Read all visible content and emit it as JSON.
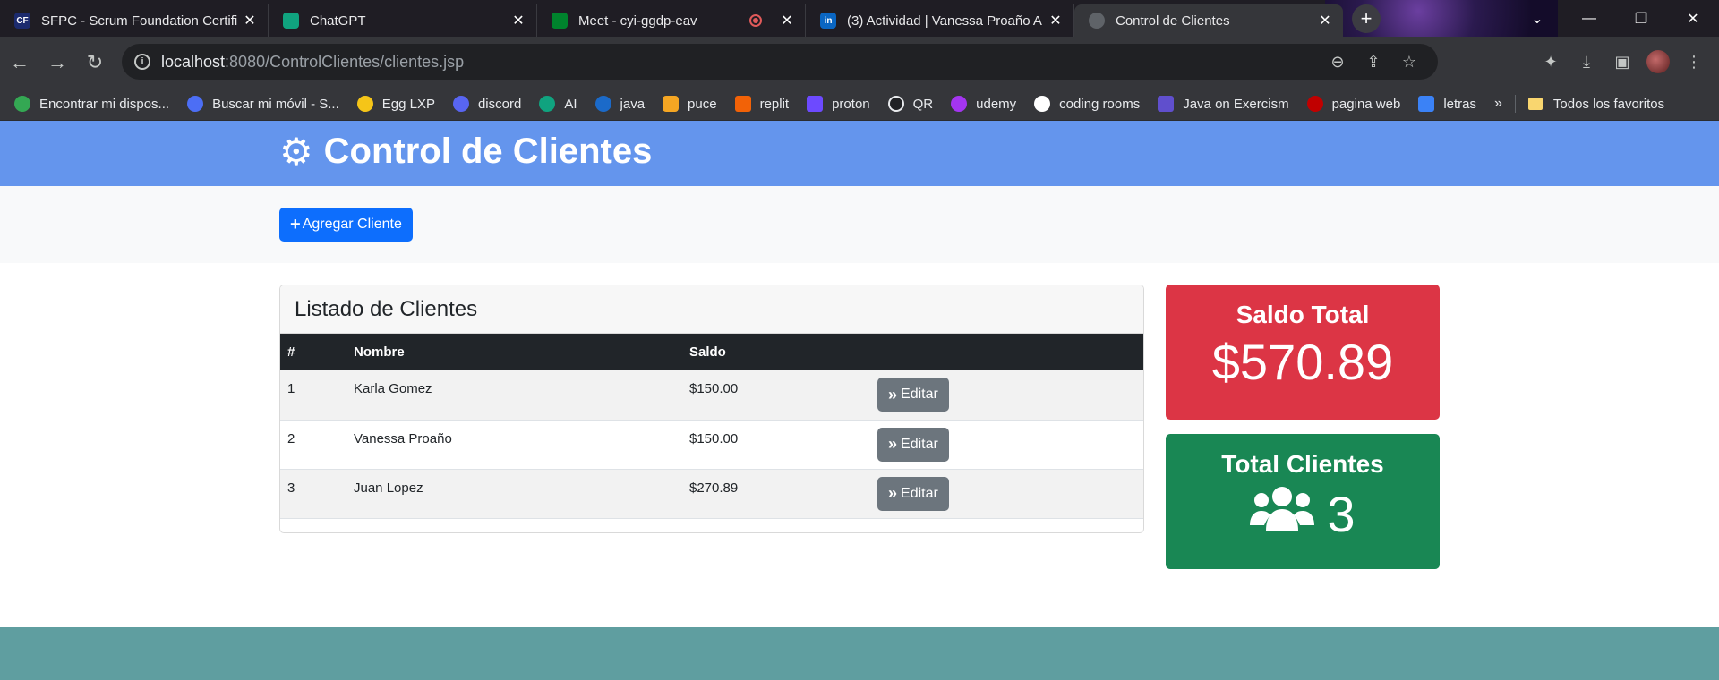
{
  "browser": {
    "tabs": [
      {
        "title": "SFPC - Scrum Foundation Certifi",
        "favicon_color": "#1c2b6e",
        "favicon_text": "CF"
      },
      {
        "title": "ChatGPT",
        "favicon_color": "#10a37f",
        "favicon_text": ""
      },
      {
        "title": "Meet - cyi-ggdp-eav",
        "favicon_color": "#00832d",
        "favicon_text": ""
      },
      {
        "title": "(3) Actividad | Vanessa Proaño A",
        "favicon_color": "#0a66c2",
        "favicon_text": "in"
      },
      {
        "title": "Control de Clientes",
        "favicon_color": "#5f6368",
        "favicon_text": ""
      }
    ],
    "url_host": "localhost",
    "url_rest": ":8080/ControlClientes/clientes.jsp",
    "bookmarks": [
      {
        "label": "Encontrar mi dispos...",
        "color": "#34a853"
      },
      {
        "label": "Buscar mi móvil - S...",
        "color": "#4c6ef5"
      },
      {
        "label": "Egg LXP",
        "color": "#f5c518"
      },
      {
        "label": "discord",
        "color": "#5865f2"
      },
      {
        "label": "AI",
        "color": "#10a37f"
      },
      {
        "label": "java",
        "color": "#1b6ac9"
      },
      {
        "label": "puce",
        "color": "#f5a623"
      },
      {
        "label": "replit",
        "color": "#f26207"
      },
      {
        "label": "proton",
        "color": "#6d4aff"
      },
      {
        "label": "QR",
        "color": "#202124"
      },
      {
        "label": "udemy",
        "color": "#a435f0"
      },
      {
        "label": "coding rooms",
        "color": "#ffffff"
      },
      {
        "label": "Java on Exercism",
        "color": "#604fcd"
      },
      {
        "label": "pagina web",
        "color": "#c00000"
      },
      {
        "label": "letras",
        "color": "#3b82f6"
      }
    ],
    "bookmarks_more": "»",
    "all_favorites": "Todos los favoritos"
  },
  "app": {
    "title": "Control de Clientes",
    "add_button": "Agregar Cliente",
    "list_title": "Listado de Clientes",
    "columns": [
      "#",
      "Nombre",
      "Saldo",
      ""
    ],
    "rows": [
      {
        "num": "1",
        "name": "Karla Gomez",
        "saldo": "$150.00",
        "action": "Editar"
      },
      {
        "num": "2",
        "name": "Vanessa Proaño",
        "saldo": "$150.00",
        "action": "Editar"
      },
      {
        "num": "3",
        "name": "Juan Lopez",
        "saldo": "$270.89",
        "action": "Editar"
      }
    ],
    "saldo_total_label": "Saldo Total",
    "saldo_total_value": "$570.89",
    "total_clientes_label": "Total Clientes",
    "total_clientes_value": "3"
  },
  "colors": {
    "header": "#6495ed",
    "primary": "#0d6efd",
    "danger": "#dc3545",
    "success": "#198754",
    "secondary": "#6c757d",
    "footer": "#5f9ea0"
  }
}
